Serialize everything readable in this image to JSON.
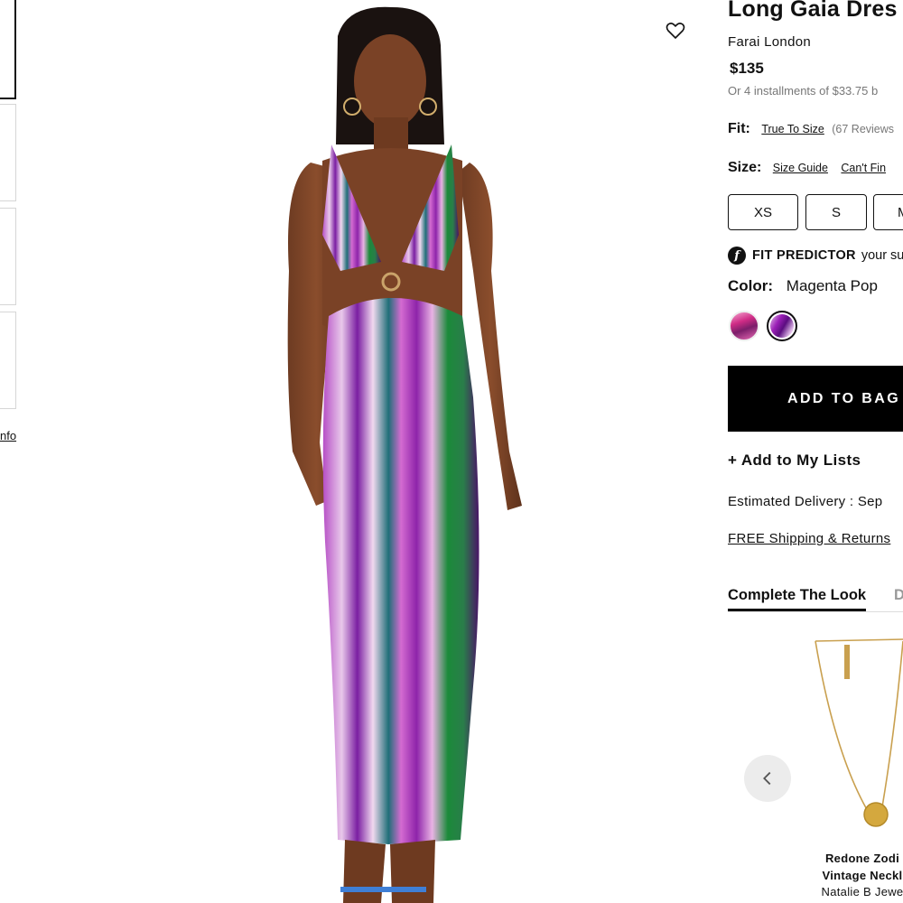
{
  "gallery": {
    "info_link": "nfo"
  },
  "product": {
    "title": "Long Gaia Dres",
    "brand": "Farai London",
    "price": "$135",
    "installments": "Or 4 installments of $33.75 b"
  },
  "fit": {
    "label": "Fit:",
    "value": "True To Size",
    "reviews": "(67 Reviews"
  },
  "size": {
    "label": "Size:",
    "guide_link": "Size Guide",
    "cant_find_link": "Can't Fin",
    "options": [
      "XS",
      "S",
      "M"
    ]
  },
  "fit_predictor": {
    "logo": "f",
    "label": "FIT PREDICTOR",
    "rest": "your su"
  },
  "color": {
    "label": "Color:",
    "selected": "Magenta Pop",
    "swatches": [
      "pink-swirl",
      "magenta-pop"
    ]
  },
  "actions": {
    "add_to_bag": "ADD TO BAG",
    "add_to_lists": "+ Add to My Lists"
  },
  "delivery": {
    "text": "Estimated Delivery : Sep "
  },
  "shipping": {
    "text": "FREE Shipping & Returns"
  },
  "tabs": {
    "complete_look": "Complete The Look",
    "second": "D"
  },
  "recommendation": {
    "name_line1": "Redone Zodi",
    "name_line2": "Vintage Neckl",
    "brand": "Natalie B Jewe"
  },
  "icons": {
    "wishlist": "heart-icon",
    "prev": "chevron-left-icon"
  },
  "colors": {
    "primary": "#111111",
    "button_bg": "#000000",
    "muted": "#777777",
    "arrow_bg": "#ececec"
  }
}
